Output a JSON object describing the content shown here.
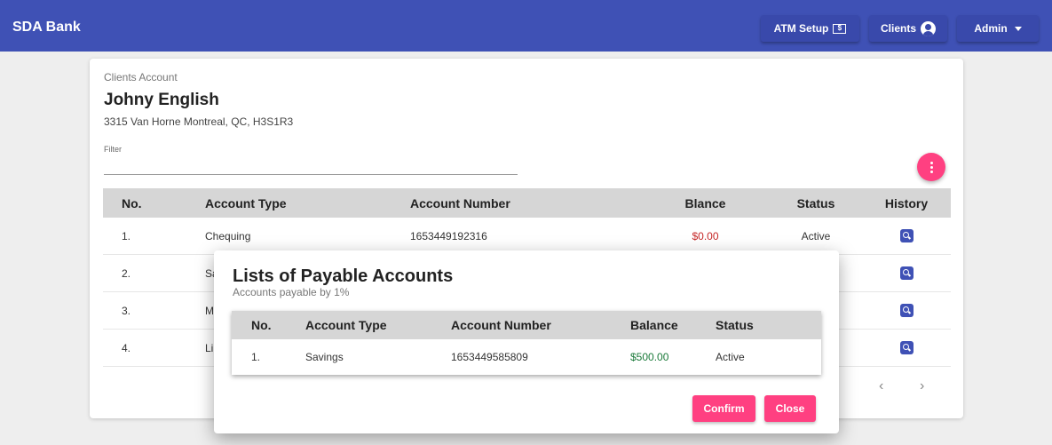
{
  "app": {
    "brand": "SDA Bank"
  },
  "nav": {
    "atm_setup": "ATM Setup",
    "atm_icon_text": "$",
    "clients": "Clients",
    "admin": "Admin"
  },
  "account": {
    "section_label": "Clients Account",
    "client_name": "Johny English",
    "address": "3315 Van Horne Montreal, QC, H3S1R3",
    "filter_label": "Filter",
    "filter_value": ""
  },
  "accounts_table": {
    "headers": [
      "No.",
      "Account Type",
      "Account Number",
      "Blance",
      "Status",
      "History"
    ],
    "rows": [
      {
        "no": "1.",
        "type": "Chequing",
        "number": "1653449192316",
        "balance": "$0.00",
        "status": "Active"
      },
      {
        "no": "2.",
        "type": "Sa",
        "number": "",
        "balance": "",
        "status": ""
      },
      {
        "no": "3.",
        "type": "M",
        "number": "",
        "balance": "",
        "status": ""
      },
      {
        "no": "4.",
        "type": "Li",
        "number": "",
        "balance": "",
        "status": ""
      }
    ]
  },
  "pager": {
    "prev": "‹",
    "next": "›"
  },
  "dialog": {
    "title": "Lists of Payable Accounts",
    "subtitle": "Accounts payable by 1%",
    "headers": [
      "No.",
      "Account Type",
      "Account Number",
      "Balance",
      "Status"
    ],
    "rows": [
      {
        "no": "1.",
        "type": "Savings",
        "number": "1653449585809",
        "balance": "$500.00",
        "status": "Active"
      }
    ],
    "confirm_label": "Confirm",
    "close_label": "Close"
  },
  "colors": {
    "primary": "#3f51b5",
    "accent": "#ff4081",
    "negative_balance": "#c62828",
    "positive_balance": "#1b7a3a"
  }
}
